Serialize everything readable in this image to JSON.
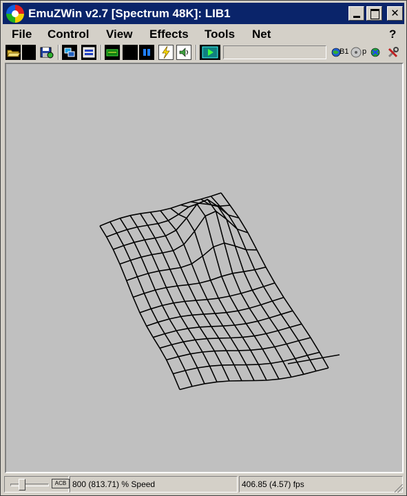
{
  "window": {
    "title": "EmuZWin v2.7 [Spectrum 48K]: LIB1"
  },
  "menu": {
    "items": [
      "File",
      "Control",
      "View",
      "Effects",
      "Tools",
      "Net"
    ],
    "help": "?"
  },
  "toolbar": {
    "right_label": "B1",
    "right_label2": "p"
  },
  "status": {
    "slider_button_label": "ACB",
    "speed_text": "800 (813.71) % Speed",
    "fps_text": "406.85 (4.57) fps"
  },
  "icons": [
    "app-icon",
    "minimize-icon",
    "maximize-icon",
    "close-icon",
    "open-folder-icon",
    "save-icon",
    "screen-icon",
    "tape-icon",
    "keyboard-icon",
    "pause-icon",
    "lightning-icon",
    "sound-icon",
    "record-icon",
    "globe-icon",
    "disk-icon",
    "network-icon",
    "tools-icon"
  ],
  "colors": {
    "titlebar": "#0a246a",
    "screen_background": "#c0c0c0",
    "wireframe": "#000000"
  }
}
